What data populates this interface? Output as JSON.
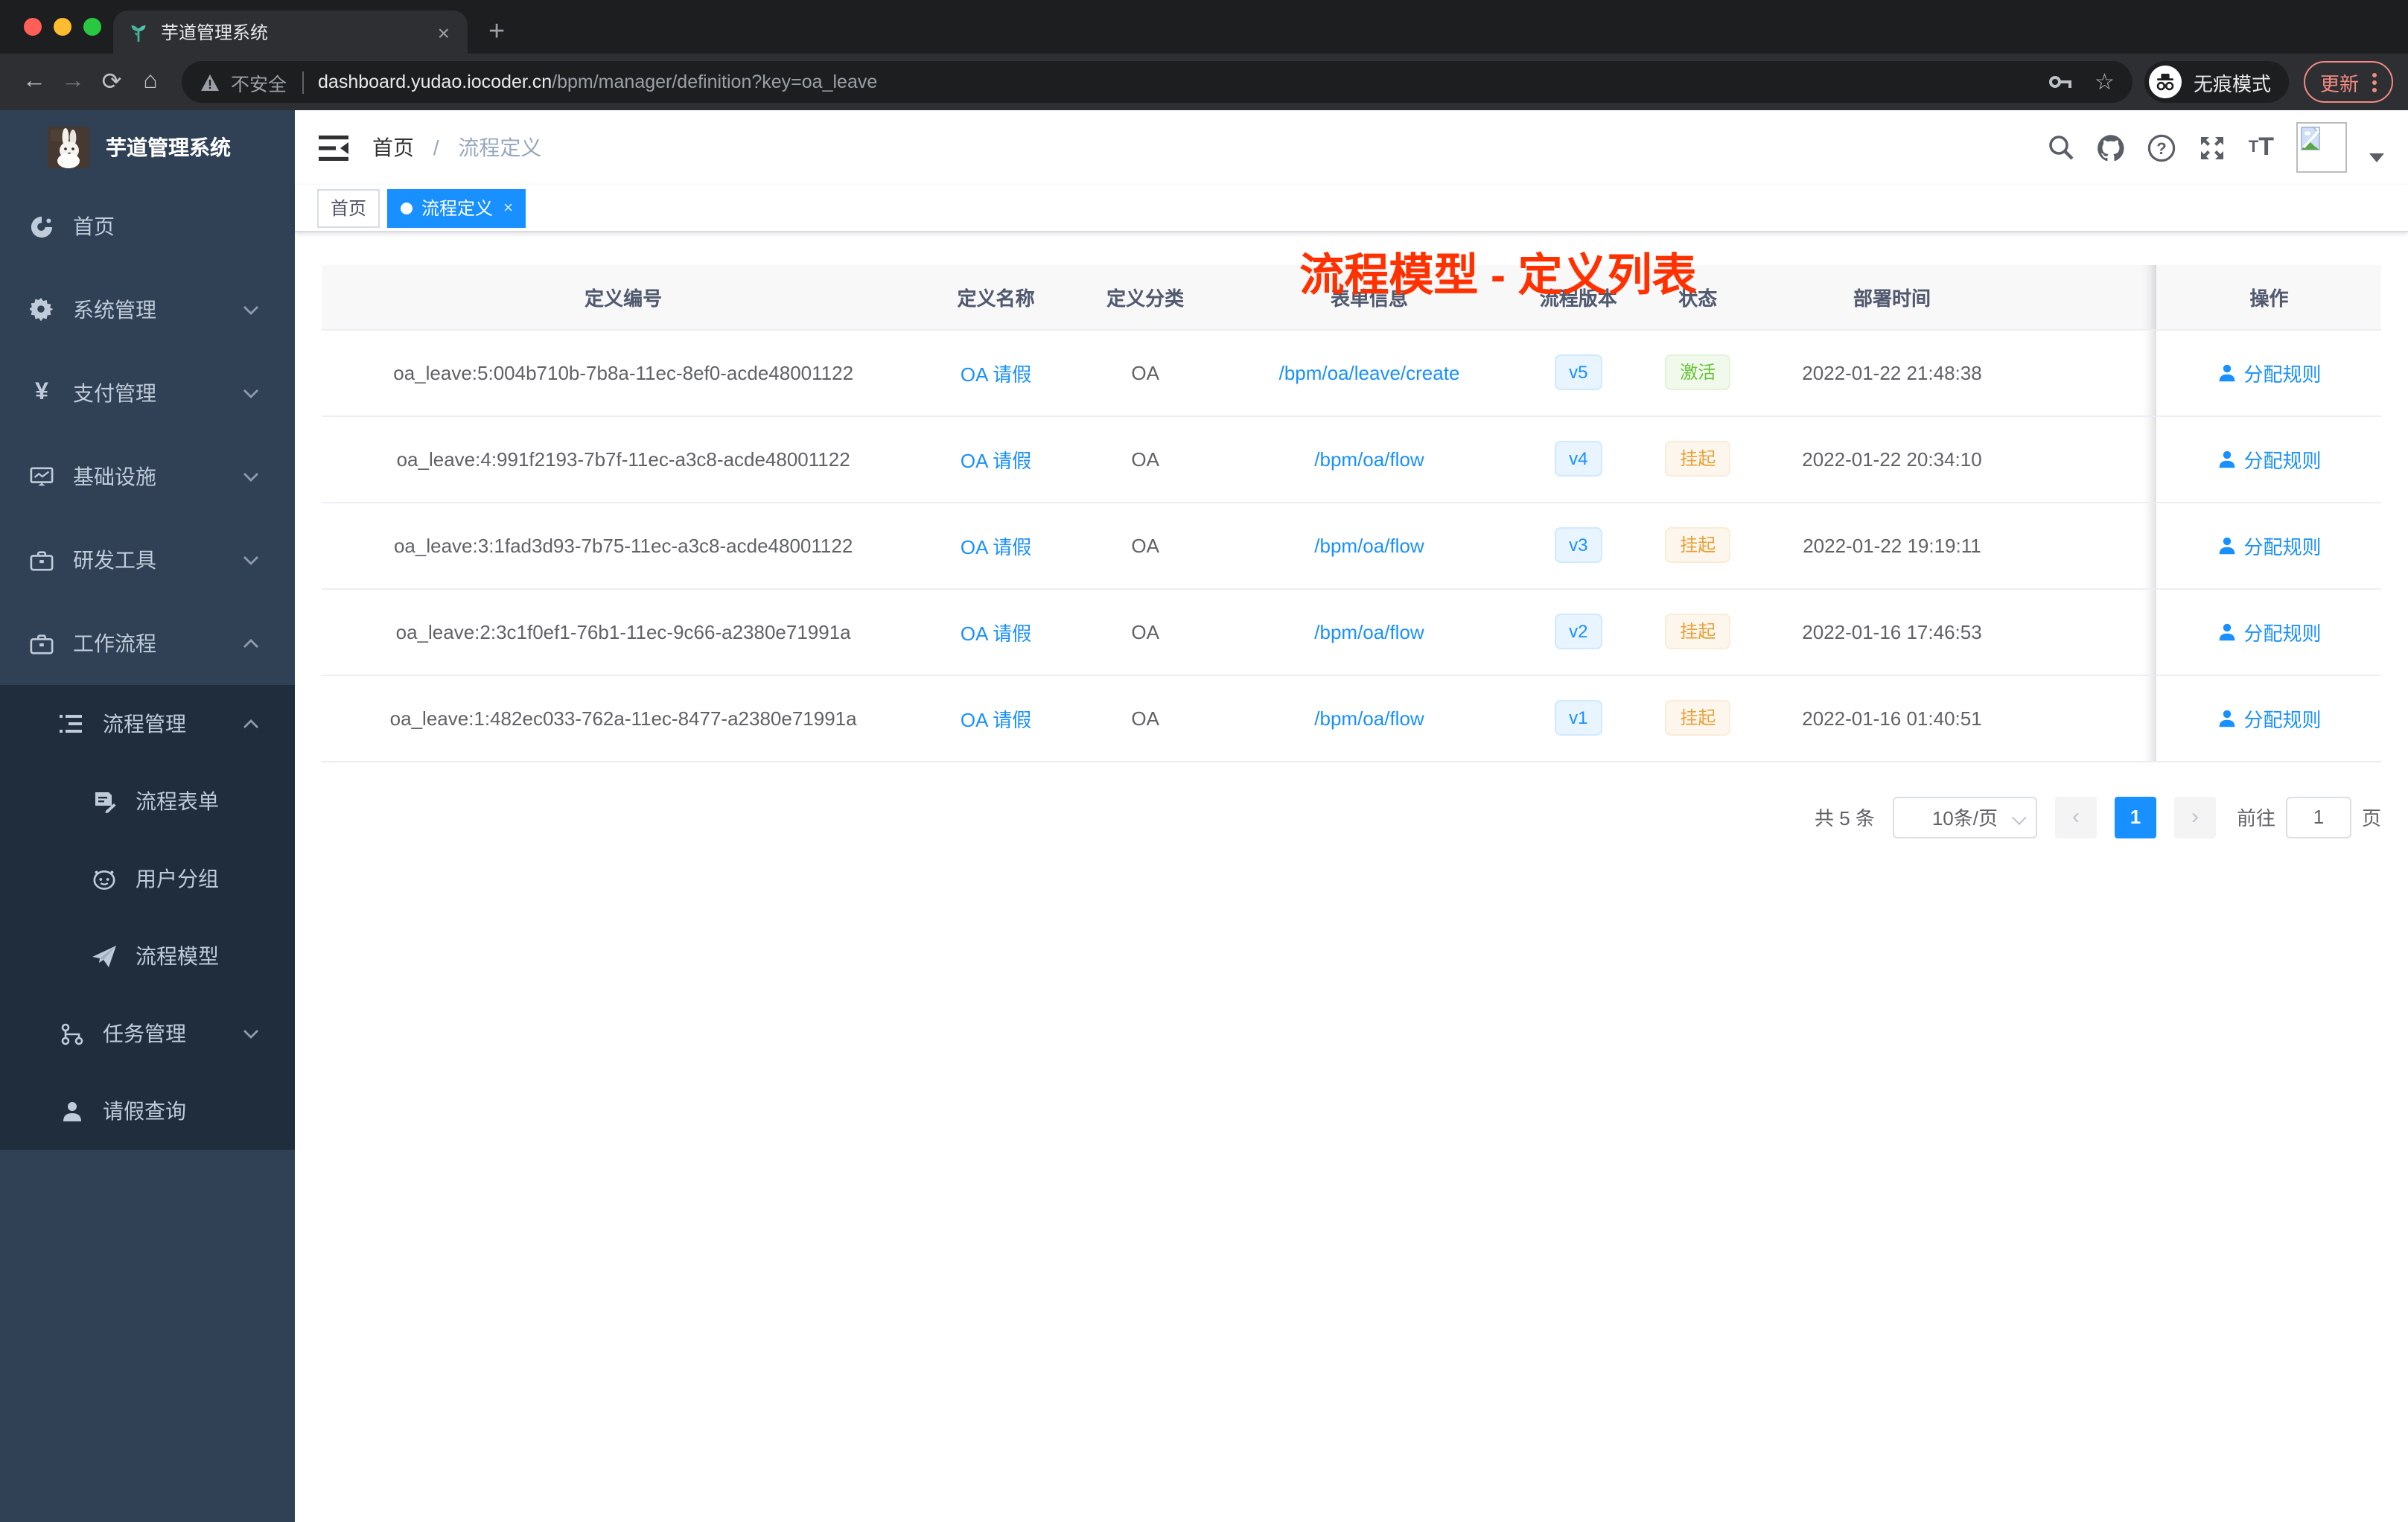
{
  "browser": {
    "tab_title": "芋道管理系统",
    "tab_close": "×",
    "new_tab": "+",
    "security_warning": "不安全",
    "url_domain": "dashboard.yudao.iocoder.cn",
    "url_path": "/bpm/manager/definition?key=oa_leave",
    "incognito_label": "无痕模式",
    "update_label": "更新"
  },
  "sidebar": {
    "title": "芋道管理系统",
    "items": [
      {
        "label": "首页"
      },
      {
        "label": "系统管理"
      },
      {
        "label": "支付管理"
      },
      {
        "label": "基础设施"
      },
      {
        "label": "研发工具"
      },
      {
        "label": "工作流程"
      },
      {
        "label": "流程管理"
      },
      {
        "label": "流程表单"
      },
      {
        "label": "用户分组"
      },
      {
        "label": "流程模型"
      },
      {
        "label": "任务管理"
      },
      {
        "label": "请假查询"
      }
    ]
  },
  "header": {
    "breadcrumb_home": "首页",
    "breadcrumb_sep": "/",
    "breadcrumb_current": "流程定义",
    "overlay_title": "流程模型 - 定义列表"
  },
  "tags": {
    "home": "首页",
    "current": "流程定义",
    "close": "×"
  },
  "table": {
    "columns": {
      "id": "定义编号",
      "name": "定义名称",
      "category": "定义分类",
      "form": "表单信息",
      "version": "流程版本",
      "status": "状态",
      "deploy_time": "部署时间",
      "actions": "操作"
    },
    "rows": [
      {
        "id": "oa_leave:5:004b710b-7b8a-11ec-8ef0-acde48001122",
        "name": "OA 请假",
        "category": "OA",
        "form": "/bpm/oa/leave/create",
        "version": "v5",
        "status": "激活",
        "deploy_time": "2022-01-22 21:48:38",
        "action": "分配规则"
      },
      {
        "id": "oa_leave:4:991f2193-7b7f-11ec-a3c8-acde48001122",
        "name": "OA 请假",
        "category": "OA",
        "form": "/bpm/oa/flow",
        "version": "v4",
        "status": "挂起",
        "deploy_time": "2022-01-22 20:34:10",
        "action": "分配规则"
      },
      {
        "id": "oa_leave:3:1fad3d93-7b75-11ec-a3c8-acde48001122",
        "name": "OA 请假",
        "category": "OA",
        "form": "/bpm/oa/flow",
        "version": "v3",
        "status": "挂起",
        "deploy_time": "2022-01-22 19:19:11",
        "action": "分配规则"
      },
      {
        "id": "oa_leave:2:3c1f0ef1-76b1-11ec-9c66-a2380e71991a",
        "name": "OA 请假",
        "category": "OA",
        "form": "/bpm/oa/flow",
        "version": "v2",
        "status": "挂起",
        "deploy_time": "2022-01-16 17:46:53",
        "action": "分配规则"
      },
      {
        "id": "oa_leave:1:482ec033-762a-11ec-8477-a2380e71991a",
        "name": "OA 请假",
        "category": "OA",
        "form": "/bpm/oa/flow",
        "version": "v1",
        "status": "挂起",
        "deploy_time": "2022-01-16 01:40:51",
        "action": "分配规则"
      }
    ]
  },
  "pagination": {
    "total": "共 5 条",
    "page_size": "10条/页",
    "prev": "‹",
    "page": "1",
    "next": "›",
    "goto": "前往",
    "goto_value": "1",
    "unit": "页"
  },
  "colors": {
    "primary": "#1890ff",
    "success": "#67c23a",
    "warning": "#e6a23c",
    "overlay_red": "#ff3100"
  }
}
